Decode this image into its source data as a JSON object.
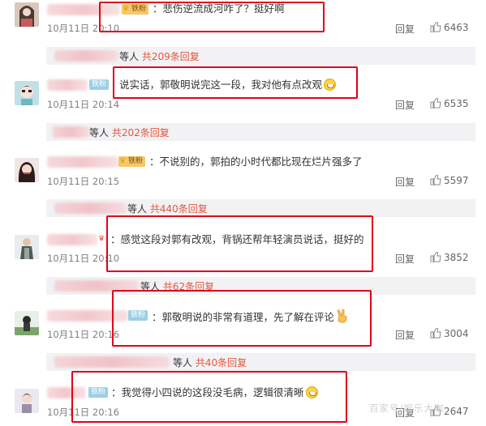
{
  "comments": [
    {
      "avatar": "avatar-1",
      "badge": "",
      "badge_type": "gold",
      "text": "：悲伤逆流成河咋了？挺好啊",
      "emoji": "",
      "time": "10月11日 20:10",
      "reply": "回复",
      "likes": "6463",
      "sub_prefix": "等人",
      "sub_count": "共209条回复"
    },
    {
      "avatar": "avatar-2",
      "badge": "铁粉",
      "badge_type": "iron",
      "text": "说实话，郭敬明说完这一段，我对他有点改观",
      "emoji": "grin-emoji",
      "time": "10月11日 20:14",
      "reply": "回复",
      "likes": "6535",
      "sub_prefix": "等人",
      "sub_count": "共202条回复"
    },
    {
      "avatar": "avatar-3",
      "badge": "",
      "badge_type": "gold",
      "text": "：不说别的，郭拍的小时代都比现在烂片强多了",
      "emoji": "",
      "time": "10月11日 20:15",
      "reply": "回复",
      "likes": "5597",
      "sub_prefix": "等人",
      "sub_count": "共440条回复"
    },
    {
      "avatar": "avatar-4",
      "badge": "",
      "badge_type": "gold",
      "text": "：感觉这段对郭有改观，背锅还帮年轻演员说话，挺好的",
      "emoji": "",
      "time": "10月11日 20:10",
      "reply": "回复",
      "likes": "3852",
      "sub_prefix": "等人",
      "sub_count": "共62条回复"
    },
    {
      "avatar": "avatar-5",
      "badge": "铁粉",
      "badge_type": "iron",
      "text": "：郭敬明说的非常有道理，先了解在评论",
      "emoji": "victory-hand-emoji",
      "time": "10月11日 20:16",
      "reply": "回复",
      "likes": "3004",
      "sub_prefix": "等人",
      "sub_count": "共40条回复"
    },
    {
      "avatar": "avatar-6",
      "badge": "铁粉",
      "badge_type": "iron",
      "text": "：我觉得小四说的这段没毛病，逻辑很清晰",
      "emoji": "grin-emoji",
      "time": "10月11日 20:16",
      "reply": "回复",
      "likes": "2647"
    }
  ],
  "colors": {
    "highlight": "#e0001b",
    "count": "#e6553a",
    "subbar": "#f2f2f5",
    "iron_badge": "#9ccfe8",
    "gold_badge": "#f6c76a"
  },
  "watermark": "百家号/娱乐大咖"
}
